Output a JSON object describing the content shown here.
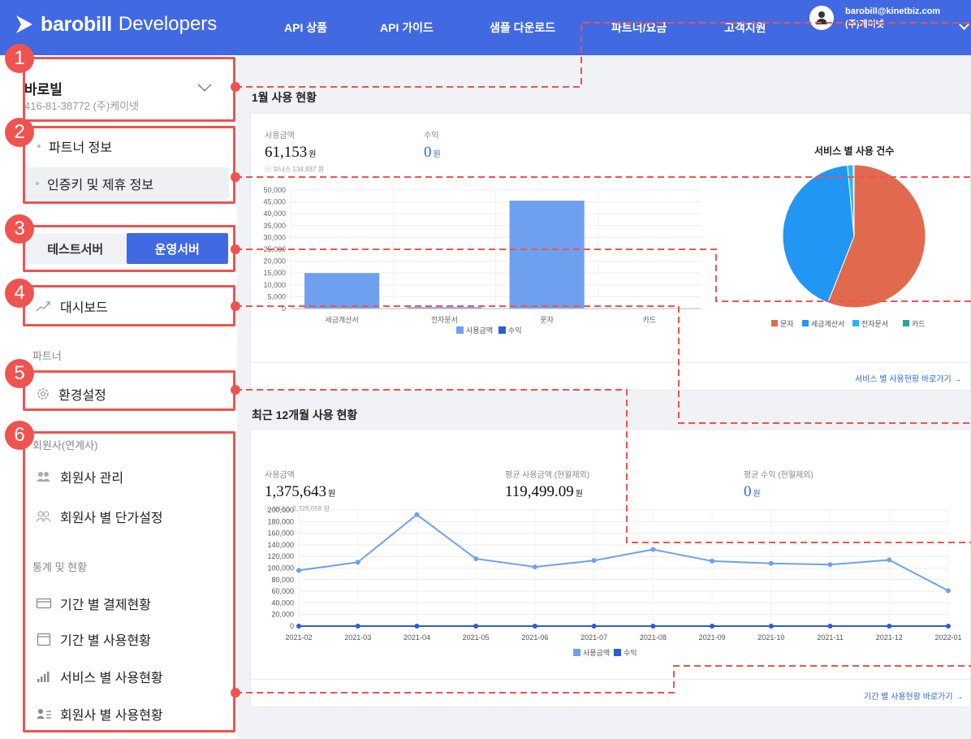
{
  "header": {
    "brand": "barobill",
    "brand_sub": "Developers",
    "nav": [
      "API 상품",
      "API 가이드",
      "샘플 다운로드",
      "파트너/요금",
      "고객지원"
    ],
    "user_email": "barobill@kinetbiz.com",
    "user_company": "(주)케이넷"
  },
  "sidebar": {
    "company_name": "바로빌",
    "company_sub": "416-81-38772 (주)케이넷",
    "partner_info": "파트너 정보",
    "auth_key": "인증키 및 제휴 정보",
    "test_server": "테스트서버",
    "live_server": "운영서버",
    "dashboard": "대시보드",
    "partner_section": "파트너",
    "settings": "환경설정",
    "members_section": "회원사(연계사)",
    "member_manage": "회원사 관리",
    "member_price": "회원사 별 단가설정",
    "stats_section": "통계 및 현황",
    "period_payment": "기간 별 결제현황",
    "period_usage": "기간 별 사용현황",
    "service_usage": "서비스 별 사용현황",
    "member_usage": "회원사 별 사용현황"
  },
  "annotations": [
    "1",
    "2",
    "3",
    "4",
    "5",
    "6"
  ],
  "monthly": {
    "title": "1월 사용 현황",
    "usage_label": "사용금액",
    "usage_value": "61,153",
    "usage_unit": "원",
    "usage_note": "ⓘ 보너스 134,937 원",
    "profit_label": "수익",
    "profit_value": "0",
    "profit_unit": "원",
    "pie_title": "서비스 별 사용 건수",
    "link": "서비스 별 사용현황 바로가기 →"
  },
  "yearly": {
    "title": "최근 12개월 사용 현황",
    "usage_label": "사용금액",
    "usage_value": "1,375,643",
    "usage_unit": "원",
    "usage_note": "ⓘ 보너스 2,329,058 원",
    "avg_label": "평균 사용금액 (현월제외)",
    "avg_value": "119,499.09",
    "avg_unit": "원",
    "avg_profit_label": "평균 수익 (현월제외)",
    "avg_profit_value": "0",
    "avg_profit_unit": "원",
    "link": "기간 별 사용현황 바로가기 →"
  },
  "colors": {
    "primary": "#4169e1",
    "annotation": "#ef5350",
    "usage_series": "#6fa0f0",
    "profit_series": "#2e5bd6",
    "pie_text": "#e16a4e",
    "pie_tax": "#2196f3",
    "pie_doc": "#29b6f6",
    "pie_card": "#26a69a"
  },
  "chart_data": [
    {
      "type": "bar",
      "categories": [
        "세금계산서",
        "전자문서",
        "문자",
        "카드"
      ],
      "series": [
        {
          "name": "사용금액",
          "values": [
            15000,
            600,
            45500,
            0
          ]
        },
        {
          "name": "수익",
          "values": [
            0,
            0,
            0,
            0
          ]
        }
      ],
      "ylim": [
        0,
        50000
      ],
      "yticks": [
        0,
        5000,
        10000,
        15000,
        20000,
        25000,
        30000,
        35000,
        40000,
        45000,
        50000
      ],
      "ytick_labels": [
        "0",
        "5,000",
        "10,000",
        "15,000",
        "20,000",
        "25,000",
        "30,000",
        "35,000",
        "40,000",
        "45,000",
        "50,000"
      ],
      "legend": "bottom"
    },
    {
      "type": "pie",
      "title": "서비스 별 사용 건수",
      "labels": [
        "문자",
        "세금계산서",
        "전자문서",
        "카드"
      ],
      "values": [
        56,
        42.5,
        1.3,
        0.2
      ],
      "legend": "bottom"
    },
    {
      "type": "line",
      "x": [
        "2021-02",
        "2021-03",
        "2021-04",
        "2021-05",
        "2021-06",
        "2021-07",
        "2021-08",
        "2021-09",
        "2021-10",
        "2021-11",
        "2021-12",
        "2022-01"
      ],
      "series": [
        {
          "name": "사용금액",
          "values": [
            96000,
            110000,
            192000,
            116000,
            102000,
            113000,
            132000,
            112000,
            108000,
            106000,
            114000,
            61000
          ]
        },
        {
          "name": "수익",
          "values": [
            0,
            0,
            0,
            0,
            0,
            0,
            0,
            0,
            0,
            0,
            0,
            0
          ]
        }
      ],
      "ylim": [
        0,
        200000
      ],
      "yticks": [
        0,
        20000,
        40000,
        60000,
        80000,
        100000,
        120000,
        140000,
        160000,
        180000,
        200000
      ],
      "ytick_labels": [
        "0",
        "20,000",
        "40,000",
        "60,000",
        "80,000",
        "100,000",
        "120,000",
        "140,000",
        "160,000",
        "180,000",
        "200,000"
      ],
      "legend": "bottom"
    }
  ]
}
